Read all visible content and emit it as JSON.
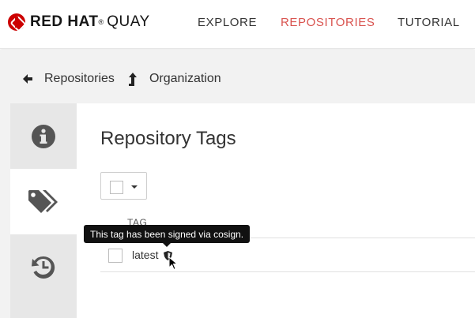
{
  "brand": {
    "logo_name": "red-hat-logo",
    "wordmark_bold": "RED HAT",
    "registered": "®",
    "wordmark_light": "QUAY"
  },
  "nav": {
    "explore": "EXPLORE",
    "repositories": "REPOSITORIES",
    "tutorial": "TUTORIAL",
    "active": "repositories",
    "active_color": "#d9534f"
  },
  "breadcrumb": {
    "items": [
      {
        "label": "Repositories",
        "icon": "arrow-left-icon"
      },
      {
        "label": "Organization",
        "icon": "level-up-icon"
      }
    ]
  },
  "sidebar": {
    "tabs": [
      {
        "icon": "info-circle-icon",
        "active": false
      },
      {
        "icon": "tags-icon",
        "active": true
      },
      {
        "icon": "history-icon",
        "active": false
      }
    ]
  },
  "main": {
    "title": "Repository Tags",
    "table": {
      "columns": [
        "TAG"
      ],
      "rows": [
        {
          "tag": "latest",
          "signed_icon": "shield-icon"
        }
      ]
    },
    "tooltip": "This tag has been signed via cosign."
  },
  "colors": {
    "brand_red": "#cc0000",
    "active_nav": "#d9534f",
    "tooltip_bg": "#111111"
  }
}
